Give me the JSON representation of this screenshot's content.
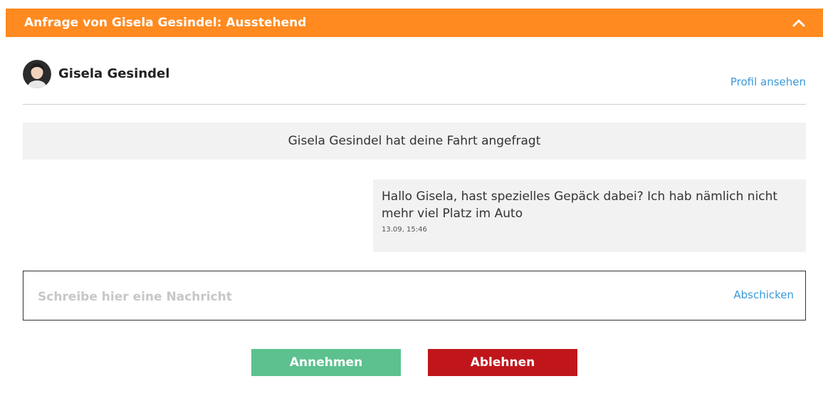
{
  "header": {
    "title": "Anfrage von Gisela Gesindel: Ausstehend",
    "accent_color": "#ff8a1f",
    "collapse_icon": "chevron-up-icon"
  },
  "profile": {
    "name": "Gisela Gesindel",
    "view_profile_label": "Profil ansehen",
    "avatar_icon": "user-avatar"
  },
  "conversation": {
    "system_message": "Gisela Gesindel hat deine Fahrt angefragt",
    "messages": [
      {
        "text": "Hallo Gisela, hast spezielles Gepäck dabei? Ich hab nämlich nicht mehr viel Platz im Auto",
        "time": "13.09, 15:46"
      }
    ]
  },
  "composer": {
    "placeholder": "Schreibe hier eine Nachricht",
    "value": "",
    "send_label": "Abschicken"
  },
  "actions": {
    "accept_label": "Annehmen",
    "decline_label": "Ablehnen",
    "accept_color": "#5cc18f",
    "decline_color": "#c0161b"
  }
}
